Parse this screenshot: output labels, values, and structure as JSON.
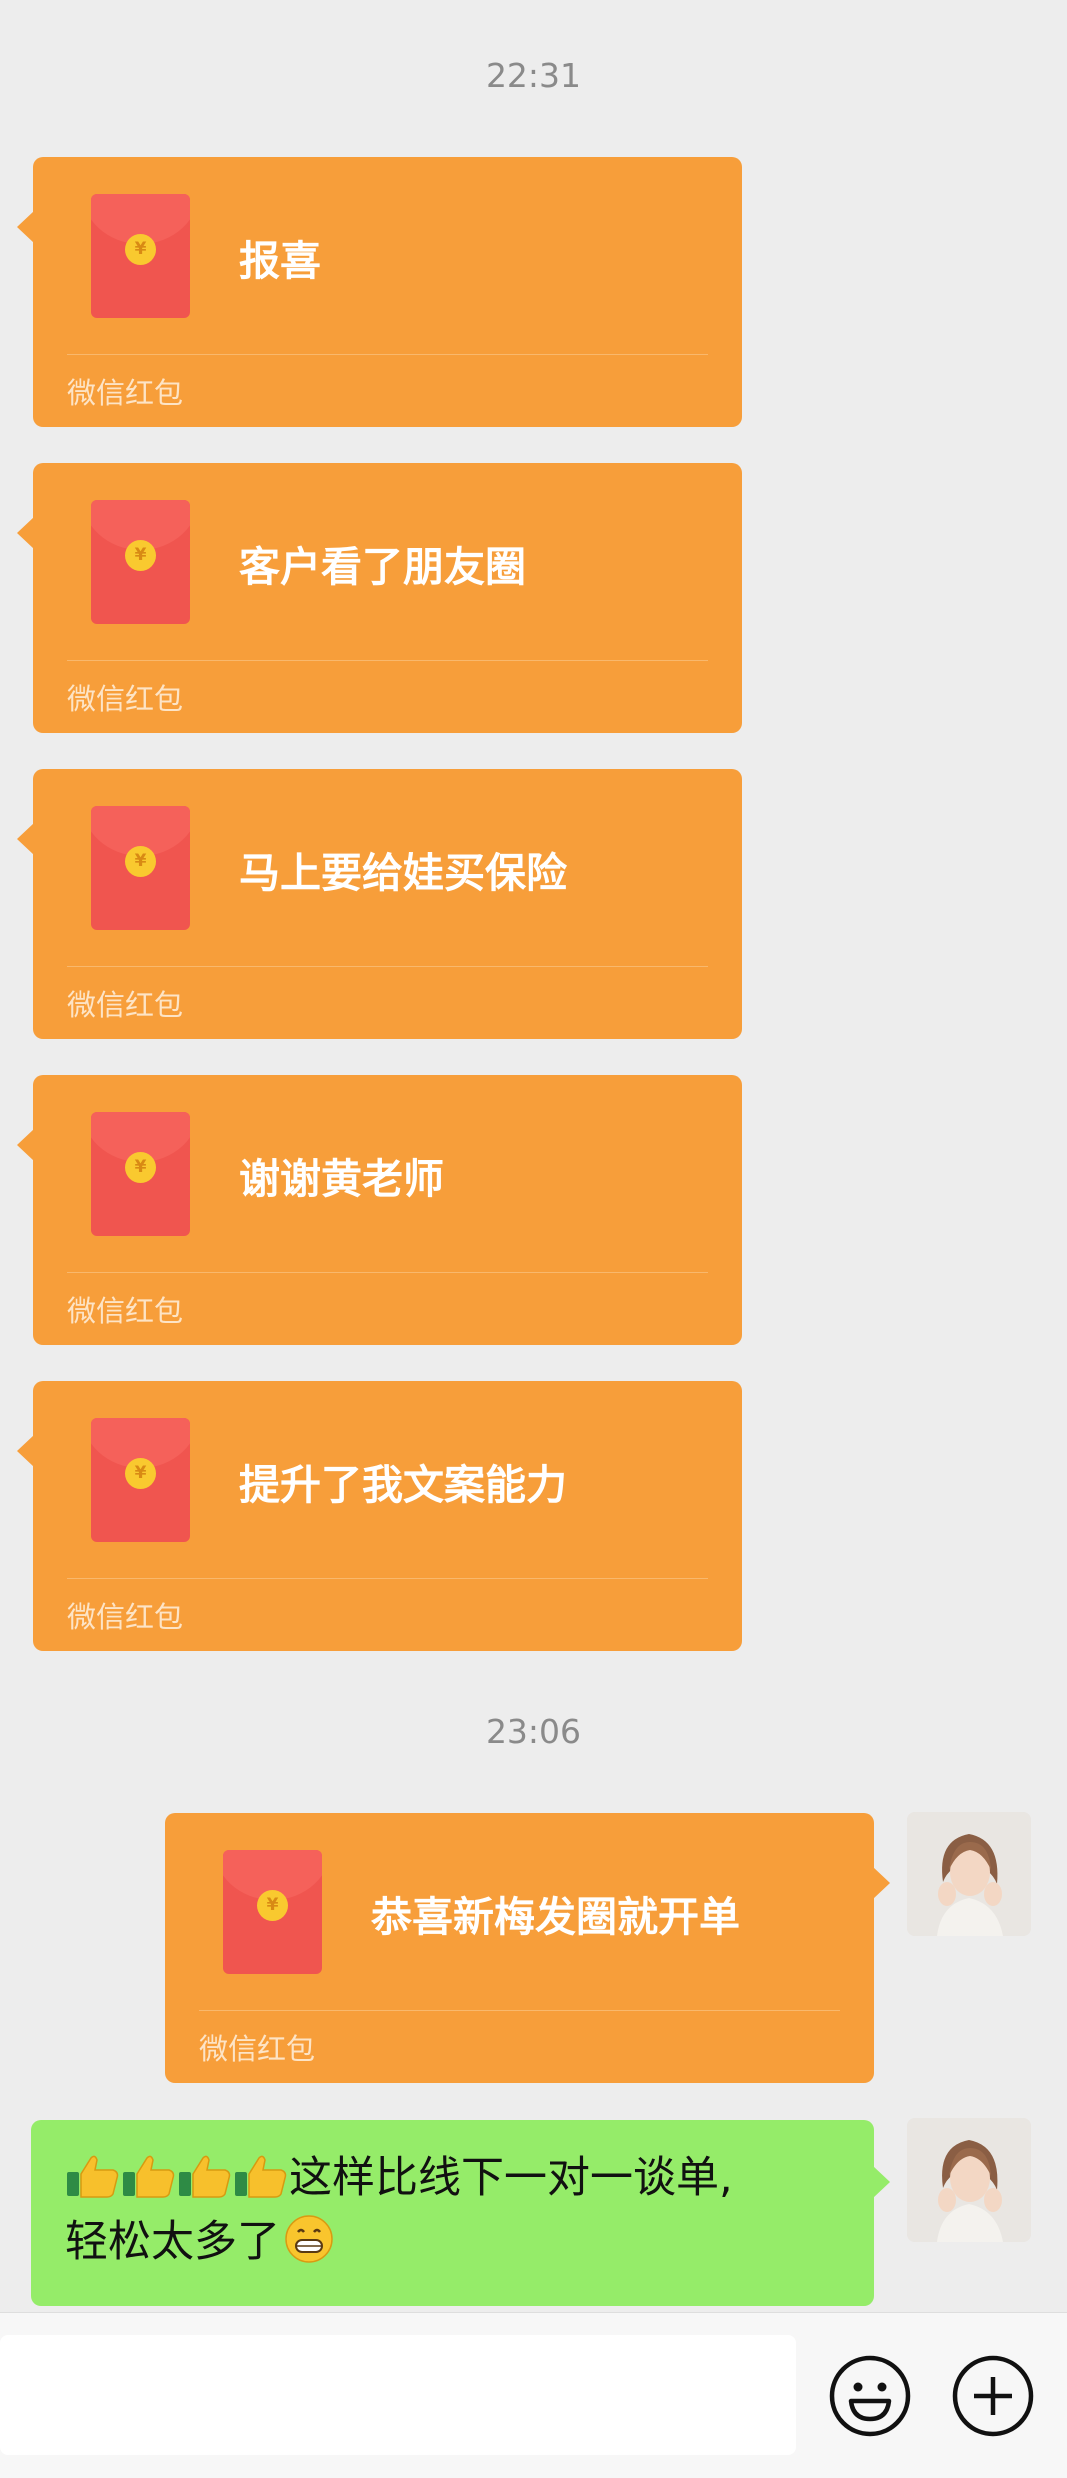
{
  "timestamps": [
    "22:31",
    "23:06"
  ],
  "incoming_packets": [
    {
      "message": "报喜",
      "label": "微信红包"
    },
    {
      "message": "客户看了朋友圈",
      "label": "微信红包"
    },
    {
      "message": "马上要给娃买保险",
      "label": "微信红包"
    },
    {
      "message": "谢谢黄老师",
      "label": "微信红包"
    },
    {
      "message": "提升了我文案能力",
      "label": "微信红包"
    }
  ],
  "outgoing_packet": {
    "message": "恭喜新梅发圈就开单",
    "label": "微信红包"
  },
  "outgoing_text": {
    "line1": "这样比线下一对一谈单,",
    "line2": "轻松太多了",
    "emoji_lead": "thumbs-up-icon ×4",
    "emoji_tail": "grinning-face-icon"
  },
  "red_packet_symbol": "¥",
  "input": {
    "placeholder": ""
  },
  "colors": {
    "background": "#ededed",
    "red_packet_bubble": "#f79e3a",
    "text_bubble": "#95ec69",
    "envelope": "#f0554f"
  }
}
